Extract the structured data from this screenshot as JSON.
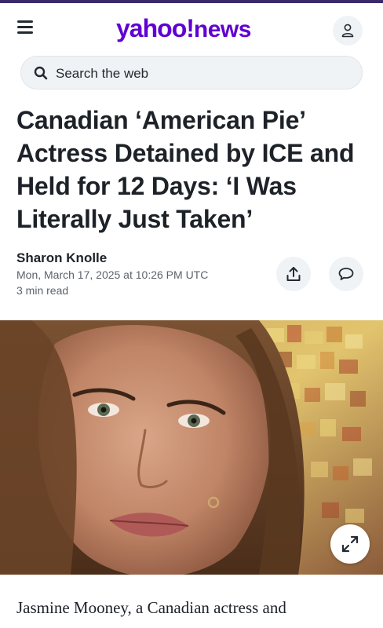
{
  "colors": {
    "brand_purple": "#6001d2",
    "text_primary": "#1d2228",
    "text_secondary": "#5b636a",
    "chip_bg": "#f0f3f5"
  },
  "header": {
    "menu_icon": "hamburger-menu-icon",
    "logo": {
      "yahoo": "yahoo",
      "bang": "!",
      "news": "news"
    },
    "profile_icon": "user-profile-icon"
  },
  "search": {
    "icon": "search-icon",
    "placeholder": "Search the web"
  },
  "article": {
    "headline": "Canadian ‘American Pie’ Actress Detained by ICE and Held for 12 Days: ‘I Was Literally Just Taken’",
    "author": "Sharon Knolle",
    "timestamp": "Mon, March 17, 2025 at 10:26 PM UTC",
    "read_time": "3 min read",
    "share_icon": "share-icon",
    "comment_icon": "comment-icon",
    "expand_icon": "expand-icon",
    "body_first_line": "Jasmine Mooney, a Canadian actress and"
  }
}
